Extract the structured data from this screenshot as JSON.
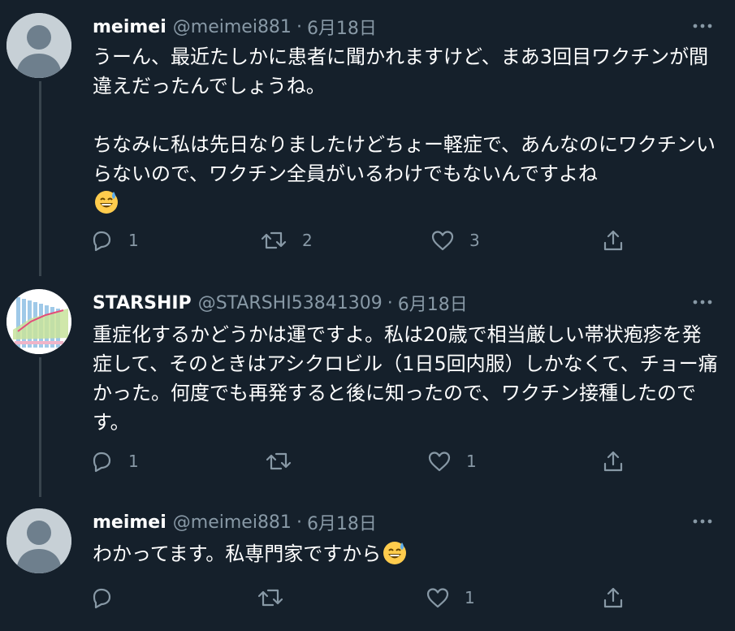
{
  "tweets": [
    {
      "name": "meimei",
      "handle": "@meimei881",
      "separator": "·",
      "date": "6月18日",
      "text": "うーん、最近たしかに患者に聞かれますけど、まあ3回目ワクチンが間違えだったんでしょうね。\n\nちなみに私は先日なりましたけどちょー軽症で、あんなのにワクチンいらないので、ワクチン全員がいるわけでもないんですよね",
      "emoji": "grinning-sweat-emoji",
      "avatar": "default-avatar",
      "replies": "1",
      "retweets": "2",
      "likes": "3"
    },
    {
      "name": "STARSHIP",
      "handle": "@STARSHI53841309",
      "separator": "·",
      "date": "6月18日",
      "text": "重症化するかどうかは運ですよ。私は20歳で相当厳しい帯状疱疹を発症して、そのときはアシクロビル（1日5回内服）しかなくて、チョー痛かった。何度でも再発すると後に知ったので、ワクチン接種したのです。",
      "avatar": "chart-avatar",
      "replies": "1",
      "retweets": "",
      "likes": "1"
    },
    {
      "name": "meimei",
      "handle": "@meimei881",
      "separator": "·",
      "date": "6月18日",
      "text": "わかってます。私専門家ですから",
      "emoji": "grinning-sweat-emoji",
      "avatar": "default-avatar",
      "replies": "",
      "retweets": "",
      "likes": "1"
    }
  ],
  "colors": {
    "background": "#15202b",
    "secondary_text": "#8899a6",
    "thread_line": "#38444d"
  }
}
